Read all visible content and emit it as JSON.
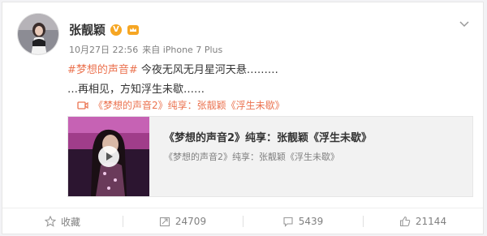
{
  "post": {
    "author": "张靓颖",
    "verified_badge": "V",
    "time": "10月27日 22:56",
    "via": "来自 iPhone 7 Plus",
    "hashtag": "#梦想的声音#",
    "line1_rest": " 今夜无风无月星河天悬………",
    "line2": "…再相见，方知浮生未歇……",
    "video_link": "《梦想的声音2》纯享：张靓颖《浮生未歇》"
  },
  "media": {
    "title": "《梦想的声音2》纯享：张靓颖《浮生未歇》",
    "subtitle": "《梦想的声音2》纯享：张靓颖《浮生未歇》"
  },
  "actions": {
    "favorite_label": "收藏",
    "repost_count": "24709",
    "comment_count": "5439",
    "like_count": "21144"
  },
  "colors": {
    "link_orange": "#eb7350",
    "badge_gold": "#f6a623",
    "meta_gray": "#808080"
  },
  "icons": [
    "chevron-down-icon",
    "verified-icon",
    "crown-icon",
    "video-icon",
    "play-icon",
    "star-icon",
    "repost-icon",
    "comment-icon",
    "like-icon"
  ]
}
